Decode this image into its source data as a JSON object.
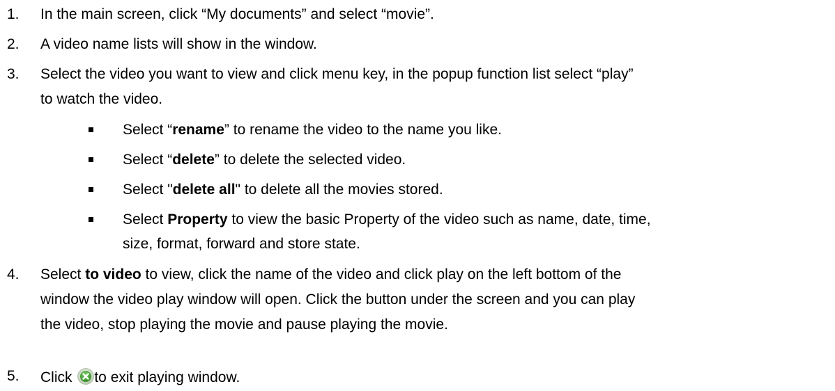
{
  "steps": [
    {
      "num": "1.",
      "text": "In the main screen, click “My documents” and select “movie”."
    },
    {
      "num": "2.",
      "text": "A video name lists will show in the window."
    },
    {
      "num": "3.",
      "text_line1": "Select the video you want to view and click menu key, in the popup function list select “play”",
      "text_line2": "to watch the video."
    },
    {
      "num": "4.",
      "pre": "Select ",
      "bold": "to video",
      "post": " to view, click the name of the video and click play on the left bottom of the",
      "line2": "window the video play window will open. Click the button under the screen and you can play",
      "line3": "the video, stop playing the movie and pause playing the movie."
    },
    {
      "num": "5.",
      "pre": "Click ",
      "post": "to exit playing window.",
      "icon": "exit-icon"
    }
  ],
  "bullets": [
    {
      "pre": "Select “",
      "bold": "rename",
      "post": "” to rename the video to the name you like."
    },
    {
      "pre": "Select “",
      "bold": "delete",
      "post": "” to delete the selected video."
    },
    {
      "pre": "Select \"",
      "bold": "delete all",
      "post": "\" to delete all the movies stored."
    },
    {
      "pre": "Select ",
      "bold": "Property",
      "post": " to view the basic Property of the video such as name, date, time,",
      "line2": "size, format, forward and store state."
    }
  ],
  "colors": {
    "text": "#000000",
    "icon_green": "#3a9a2a",
    "icon_ring": "#c9d6c2"
  }
}
